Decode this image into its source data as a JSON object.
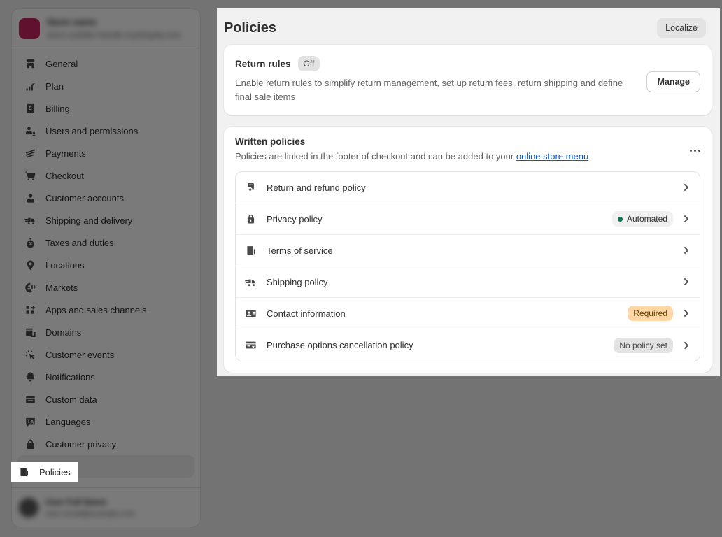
{
  "sidebar": {
    "store": {
      "name": "Store name",
      "subtitle": "store-subtitle-handle.myshopify.com"
    },
    "items": [
      {
        "label": "General",
        "icon": "store-icon"
      },
      {
        "label": "Plan",
        "icon": "plan-chart-icon"
      },
      {
        "label": "Billing",
        "icon": "billing-receipt-icon"
      },
      {
        "label": "Users and permissions",
        "icon": "users-icon"
      },
      {
        "label": "Payments",
        "icon": "payments-card-icon"
      },
      {
        "label": "Checkout",
        "icon": "cart-icon"
      },
      {
        "label": "Customer accounts",
        "icon": "person-icon"
      },
      {
        "label": "Shipping and delivery",
        "icon": "delivery-truck-icon"
      },
      {
        "label": "Taxes and duties",
        "icon": "taxes-bag-icon"
      },
      {
        "label": "Locations",
        "icon": "location-pin-icon"
      },
      {
        "label": "Markets",
        "icon": "markets-globe-icon"
      },
      {
        "label": "Apps and sales channels",
        "icon": "apps-grid-icon"
      },
      {
        "label": "Domains",
        "icon": "domains-window-icon"
      },
      {
        "label": "Customer events",
        "icon": "cursor-click-icon"
      },
      {
        "label": "Notifications",
        "icon": "bell-icon"
      },
      {
        "label": "Custom data",
        "icon": "custom-data-icon"
      },
      {
        "label": "Languages",
        "icon": "languages-icon"
      },
      {
        "label": "Customer privacy",
        "icon": "lock-icon"
      },
      {
        "label": "Policies",
        "icon": "policies-icon",
        "selected": true
      }
    ],
    "user": {
      "name": "User Full Name",
      "subtitle": "user-email@example.com"
    }
  },
  "header": {
    "title": "Policies",
    "localize_label": "Localize"
  },
  "return_rules": {
    "title": "Return rules",
    "status_badge": "Off",
    "description": "Enable return rules to simplify return management, set up return fees, return shipping and define final sale items",
    "manage_label": "Manage"
  },
  "written_policies": {
    "title": "Written policies",
    "subtitle_prefix": "Policies are linked in the footer of checkout and can be added to your ",
    "link_label": "online store menu",
    "more_label": "More actions",
    "rows": [
      {
        "label": "Return and refund policy",
        "icon": "return-refund-icon",
        "badge": null,
        "badge_type": null
      },
      {
        "label": "Privacy policy",
        "icon": "privacy-lock-icon",
        "badge": "Automated",
        "badge_type": "success"
      },
      {
        "label": "Terms of service",
        "icon": "terms-document-icon",
        "badge": null,
        "badge_type": null
      },
      {
        "label": "Shipping policy",
        "icon": "shipping-truck-icon",
        "badge": null,
        "badge_type": null
      },
      {
        "label": "Contact information",
        "icon": "contact-card-icon",
        "badge": "Required",
        "badge_type": "warning"
      },
      {
        "label": "Purchase options cancellation policy",
        "icon": "purchase-cancel-icon",
        "badge": "No policy set",
        "badge_type": "neutral"
      }
    ]
  },
  "colors": {
    "accent_link": "#005bd3",
    "success_dot": "#0c7355",
    "warning_badge_bg": "#ffd6a4",
    "brand_avatar": "#c8255e",
    "panel_bg": "#f1f1f1",
    "overlay": "rgba(0,0,0,0.52)"
  }
}
